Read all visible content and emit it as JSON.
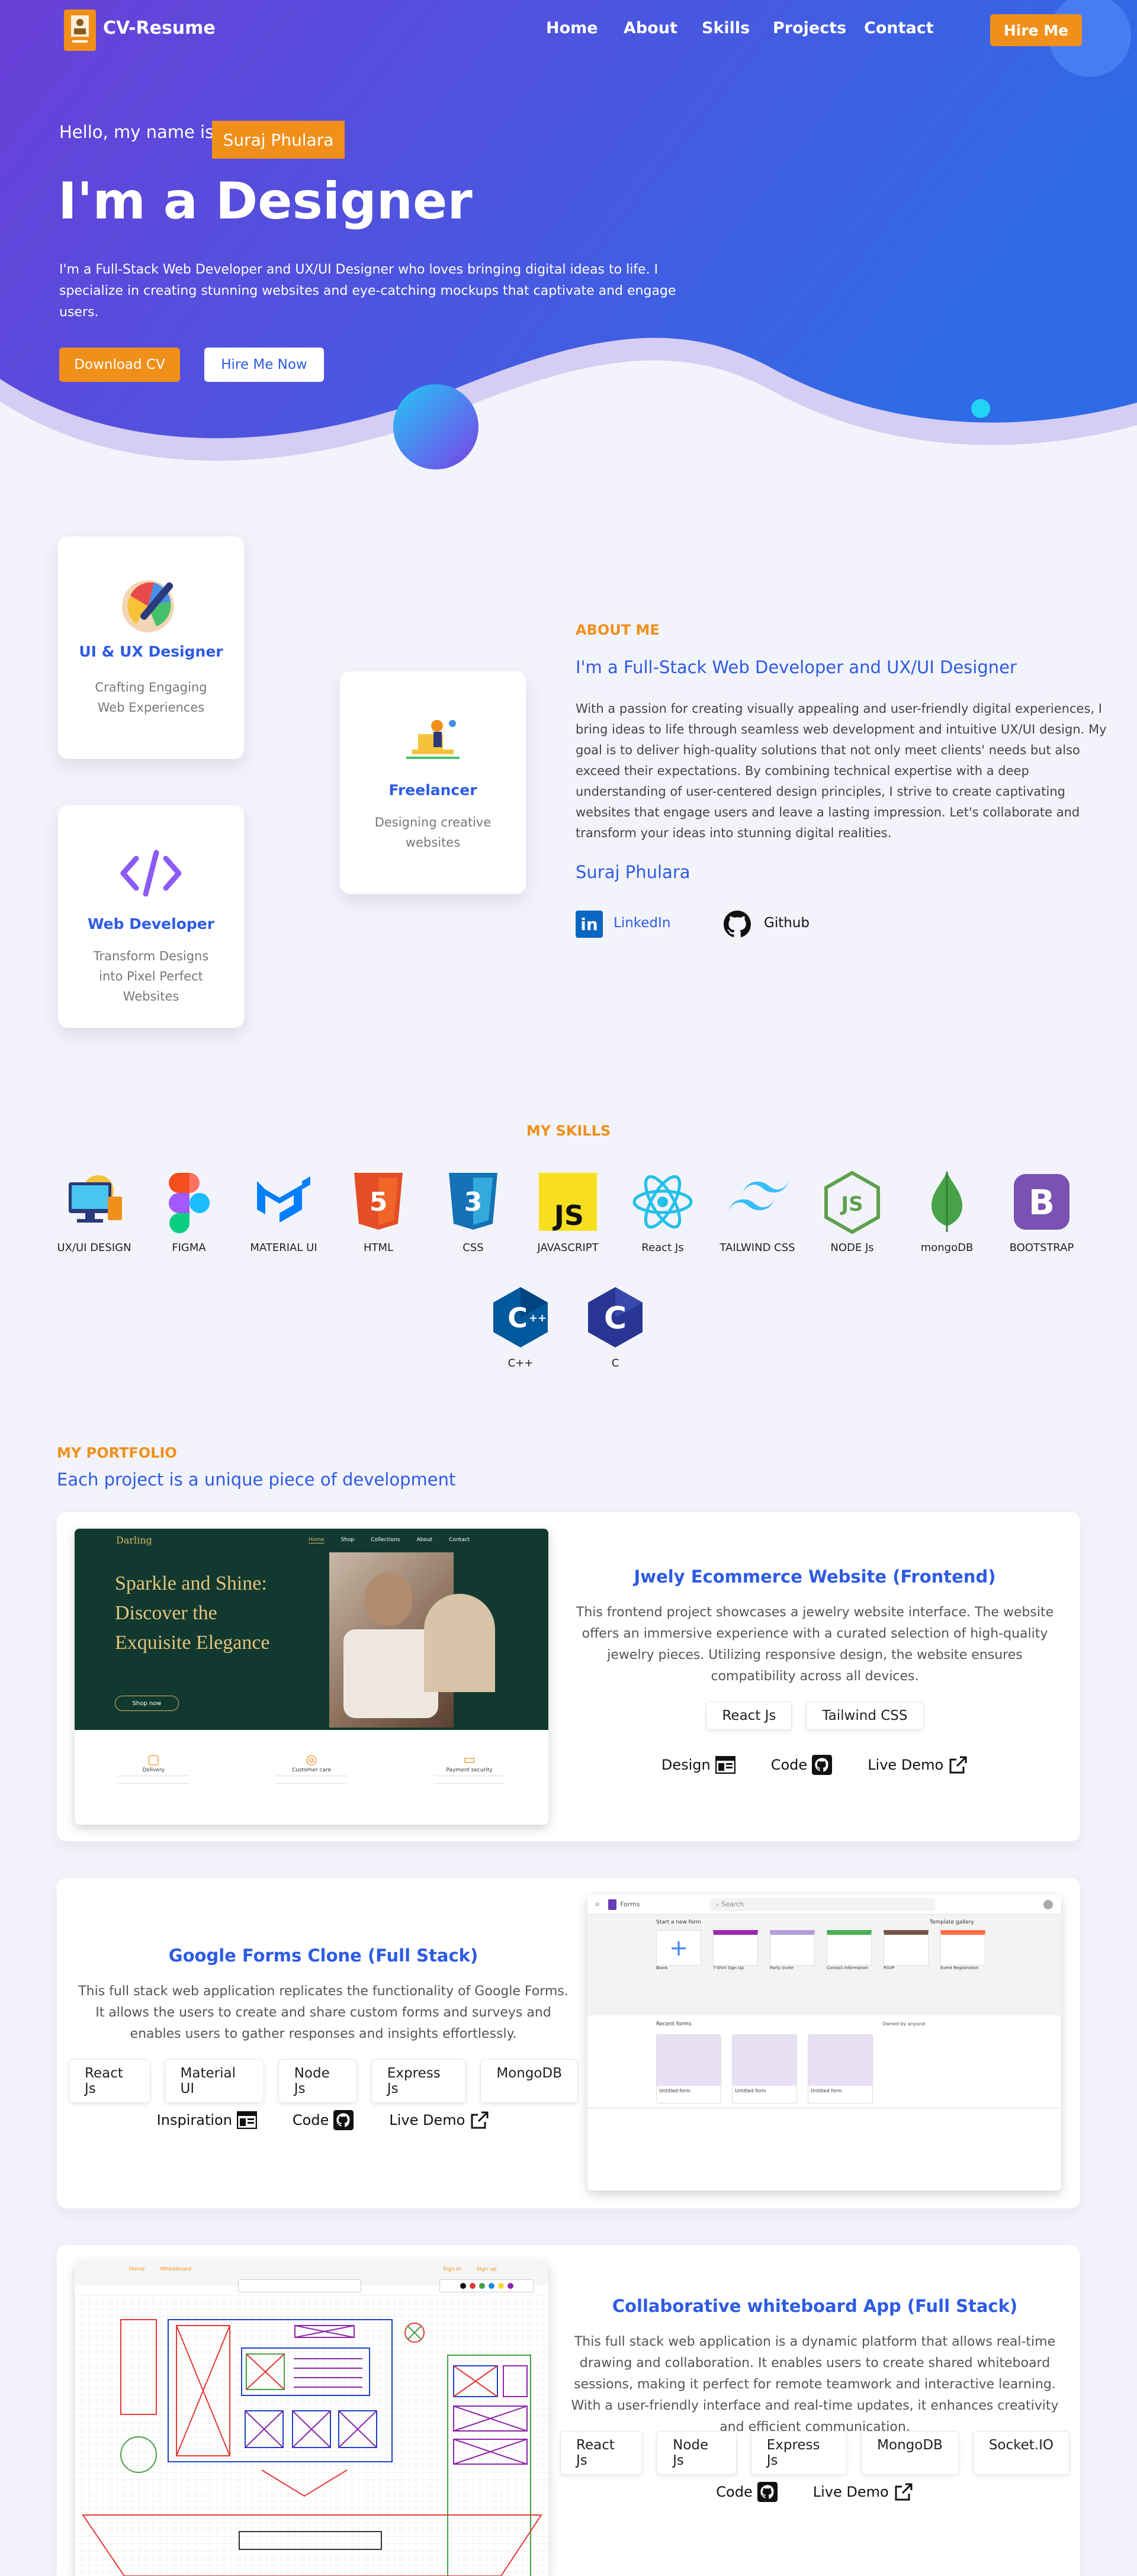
{
  "colors": {
    "accent": "#f0901a",
    "primary": "#2d5be3",
    "hero_start": "#6a3fd8",
    "hero_end": "#2f6be6"
  },
  "nav": {
    "brand": "CV-Resume",
    "links": [
      "Home",
      "About",
      "Skills",
      "Projects",
      "Contact"
    ],
    "cta": "Hire Me"
  },
  "hero": {
    "greeting": "Hello, my name is",
    "name": "Suraj Phulara",
    "headline": "I'm a Designer",
    "bio": "I'm a Full-Stack Web Developer and UX/UI Designer who loves bringing digital ideas to life. I specialize in creating stunning websites and eye-catching mockups that captivate and engage users.",
    "download": "Download CV",
    "hire": "Hire Me Now"
  },
  "services": [
    {
      "title": "UI & UX Designer",
      "desc": "Crafting Engaging Web Experiences",
      "icon": "palette-icon"
    },
    {
      "title": "Web Developer",
      "desc": "Transform Designs into Pixel Perfect Websites",
      "icon": "code-icon"
    },
    {
      "title": "Freelancer",
      "desc": "Designing creative websites",
      "icon": "freelancer-icon"
    }
  ],
  "about": {
    "label": "ABOUT ME",
    "title": "I'm a Full-Stack Web Developer and UX/UI Designer",
    "text": "With a passion for creating visually appealing and user-friendly digital experiences, I bring ideas to life through seamless web development and intuitive UX/UI design. My goal is to deliver high-quality solutions that not only meet clients' needs but also exceed their expectations. By combining technical expertise with a deep understanding of user-centered design principles, I strive to create captivating websites that engage users and leave a lasting impression. Let's collaborate and transform your ideas into stunning digital realities.",
    "signature": "Suraj Phulara",
    "linkedin": "LinkedIn",
    "github": "Github"
  },
  "skills": {
    "label": "MY SKILLS",
    "items": [
      "UX/UI DESIGN",
      "FIGMA",
      "MATERIAL UI",
      "HTML",
      "CSS",
      "JAVASCRIPT",
      "React Js",
      "TAILWIND CSS",
      "NODE Js",
      "mongoDB",
      "BOOTSTRAP",
      "C++",
      "C"
    ]
  },
  "portfolio": {
    "label": "MY PORTFOLIO",
    "subtitle": "Each project is a unique piece of development",
    "projects": [
      {
        "title": "Jwely Ecommerce Website (Frontend)",
        "desc": "This frontend project showcases a jewelry website interface. The website offers an immersive experience with a curated selection of high-quality jewelry pieces. Utilizing responsive design, the website ensures compatibility across all devices.",
        "tags": [
          "React Js",
          "Tailwind CSS"
        ],
        "links": [
          "Design",
          "Code",
          "Live Demo"
        ],
        "shot": {
          "brand": "Darling",
          "menu": [
            "Home",
            "Shop",
            "Collections",
            "About",
            "Contact"
          ],
          "heading": "Sparkle and Shine: Discover the Exquisite Elegance",
          "button": "Shop now",
          "features": [
            "Delivery",
            "Customer care",
            "Payment security"
          ]
        }
      },
      {
        "title": "Google Forms Clone (Full Stack)",
        "desc": "This full stack web application replicates the functionality of Google Forms. It allows the users to create and share custom forms and surveys and enables users to gather responses and insights effortlessly.",
        "tags": [
          "React Js",
          "Material UI",
          "Node Js",
          "Express Js",
          "MongoDB"
        ],
        "links": [
          "Inspiration",
          "Code",
          "Live Demo"
        ],
        "shot": {
          "app": "Forms",
          "search": "Search",
          "start": "Start a new form",
          "gallery": "Template gallery",
          "templates": [
            "Blank",
            "T-Shirt Sign Up",
            "Party Invite",
            "Contact Information",
            "RSVP",
            "Event Registration"
          ],
          "recent": "Recent forms",
          "owner": "Owned by anyone",
          "forms": [
            "Untitled form",
            "Untitled form",
            "Untitled form"
          ]
        }
      },
      {
        "title": "Collaborative whiteboard App (Full Stack)",
        "desc": "This full stack web application is a dynamic platform that allows real-time drawing and collaboration. It enables users to create shared whiteboard sessions, making it perfect for remote teamwork and interactive learning. With a user-friendly interface and real-time updates, it enhances creativity and efficient communication.",
        "tags": [
          "React Js",
          "Node Js",
          "Express Js",
          "MongoDB",
          "Socket.IO"
        ],
        "links": [
          "Code",
          "Live Demo"
        ],
        "shot": {
          "nav": [
            "Home",
            "Whiteboard"
          ],
          "auth": [
            "Sign in",
            "Sign up"
          ]
        }
      }
    ]
  }
}
